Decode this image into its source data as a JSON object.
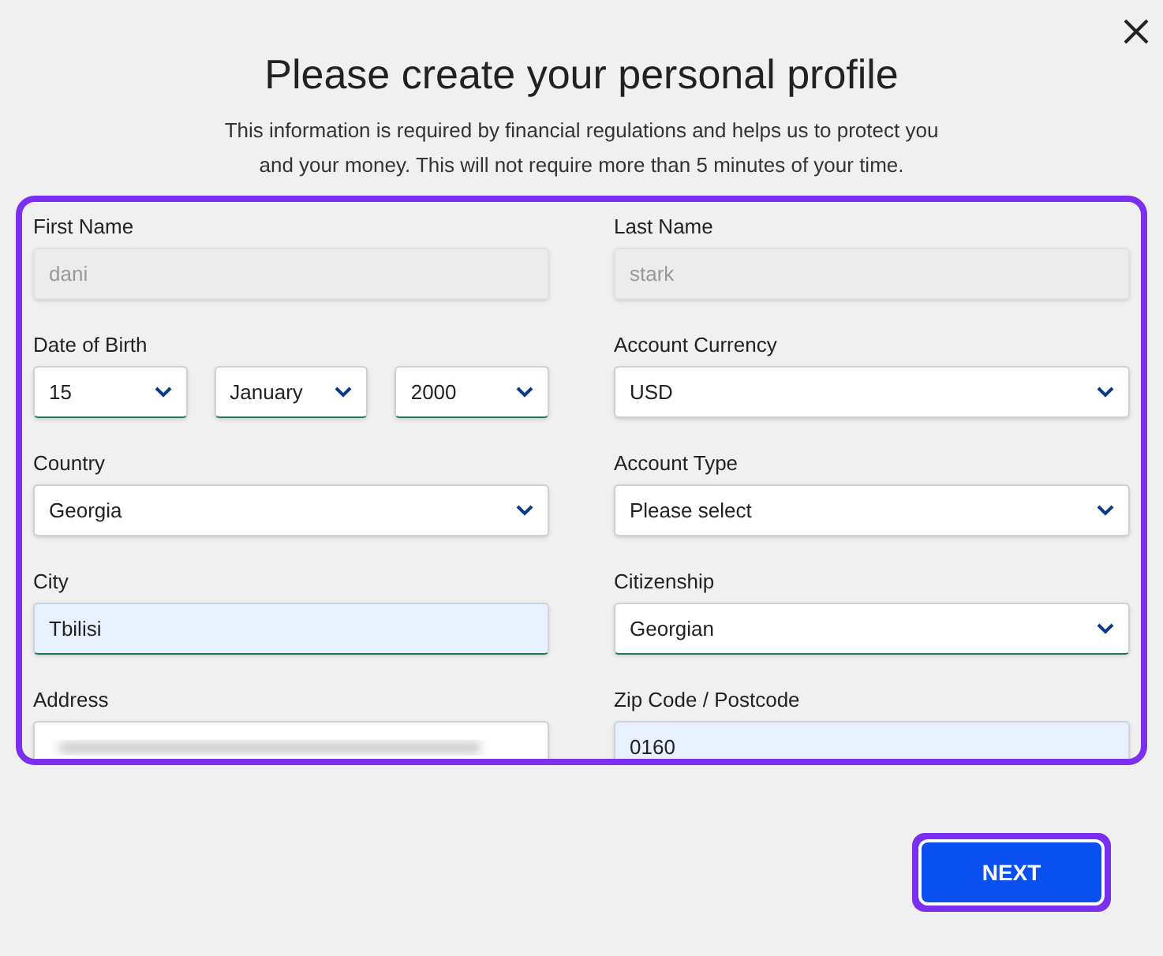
{
  "dialog": {
    "title": "Please create your personal profile",
    "subtitle": "This information is required by financial regulations and helps us to protect you and your money. This will not require more than 5 minutes of your time."
  },
  "form_rows": [
    {
      "fields": [
        {
          "label": "First Name",
          "controls": [
            {
              "kind": "input",
              "value": "dani",
              "disabled": true,
              "valid": false
            }
          ]
        },
        {
          "label": "Last Name",
          "controls": [
            {
              "kind": "input",
              "value": "stark",
              "disabled": true,
              "valid": false
            }
          ]
        }
      ]
    },
    {
      "fields": [
        {
          "label": "Date of Birth",
          "controls": [
            {
              "kind": "select",
              "value": "15",
              "disabled": false,
              "autofilled": false,
              "valid": true
            },
            {
              "kind": "select",
              "value": "January",
              "disabled": false,
              "autofilled": false,
              "valid": true
            },
            {
              "kind": "select",
              "value": "2000",
              "disabled": false,
              "autofilled": false,
              "valid": true
            }
          ]
        },
        {
          "label": "Account Currency",
          "controls": [
            {
              "kind": "select",
              "value": "USD",
              "disabled": false,
              "autofilled": false,
              "valid": false
            }
          ]
        }
      ]
    },
    {
      "fields": [
        {
          "label": "Country",
          "controls": [
            {
              "kind": "select",
              "value": "Georgia",
              "disabled": false,
              "autofilled": false,
              "valid": false
            }
          ]
        },
        {
          "label": "Account Type",
          "controls": [
            {
              "kind": "select",
              "value": "Please select",
              "disabled": false,
              "autofilled": false,
              "valid": false
            }
          ]
        }
      ]
    },
    {
      "fields": [
        {
          "label": "City",
          "controls": [
            {
              "kind": "input",
              "value": "Tbilisi",
              "disabled": false,
              "autofilled": true,
              "valid": true
            }
          ]
        },
        {
          "label": "Citizenship",
          "controls": [
            {
              "kind": "select",
              "value": "Georgian",
              "disabled": false,
              "autofilled": false,
              "valid": true
            }
          ]
        }
      ]
    },
    {
      "fields": [
        {
          "label": "Address",
          "controls": [
            {
              "kind": "redacted",
              "disabled": false,
              "autofilled": false
            }
          ]
        },
        {
          "label": "Zip Code / Postcode",
          "controls": [
            {
              "kind": "input",
              "value": "0160",
              "disabled": false,
              "autofilled": true
            }
          ]
        }
      ]
    }
  ],
  "next_button": {
    "label": "NEXT"
  }
}
